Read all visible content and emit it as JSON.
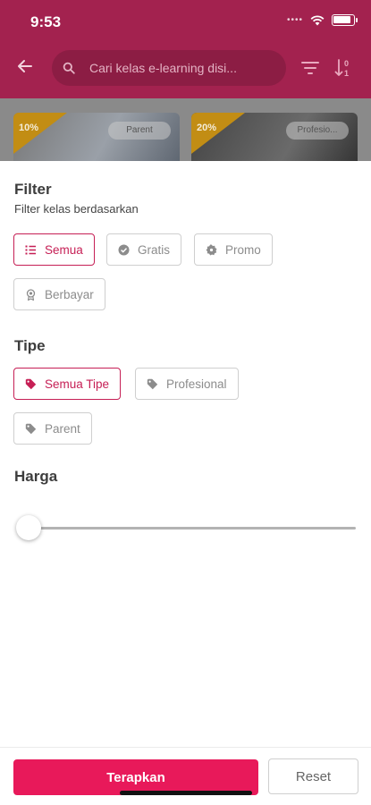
{
  "status_bar": {
    "time": "9:53"
  },
  "header": {
    "search_placeholder": "Cari kelas e-learning disi...",
    "accent_color": "#a3224f"
  },
  "cards": [
    {
      "discount": "10%",
      "tag": "Parent"
    },
    {
      "discount": "20%",
      "tag": "Profesio..."
    }
  ],
  "filter": {
    "title": "Filter",
    "subtitle": "Filter kelas berdasarkan",
    "options": [
      {
        "label": "Semua",
        "icon": "list-icon",
        "selected": true
      },
      {
        "label": "Gratis",
        "icon": "check-circle-icon",
        "selected": false
      },
      {
        "label": "Promo",
        "icon": "badge-icon",
        "selected": false
      },
      {
        "label": "Berbayar",
        "icon": "award-icon",
        "selected": false
      }
    ]
  },
  "tipe": {
    "title": "Tipe",
    "options": [
      {
        "label": "Semua Tipe",
        "icon": "tag-icon",
        "selected": true
      },
      {
        "label": "Profesional",
        "icon": "tag-icon",
        "selected": false
      },
      {
        "label": "Parent",
        "icon": "tag-icon",
        "selected": false
      }
    ]
  },
  "harga": {
    "title": "Harga",
    "value_fraction": 0.0
  },
  "actions": {
    "apply_label": "Terapkan",
    "reset_label": "Reset"
  },
  "colors": {
    "primary": "#e8195a",
    "chip_active": "#c61f55"
  }
}
